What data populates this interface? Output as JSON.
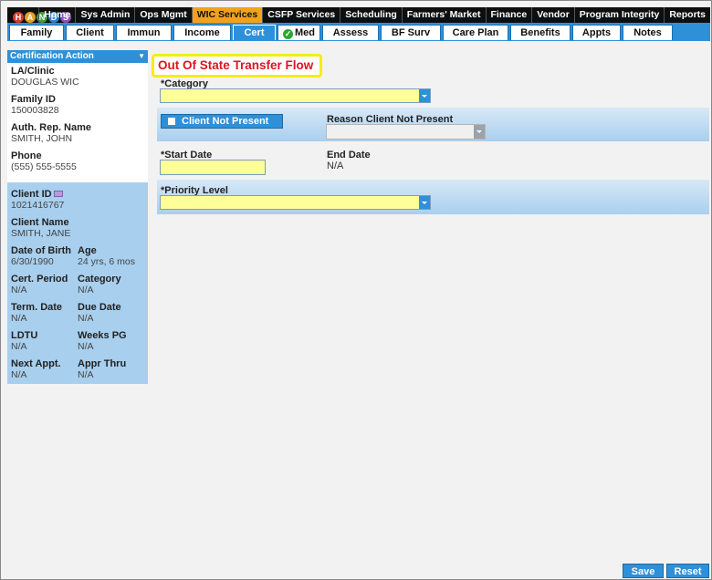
{
  "logo": {
    "letters": [
      "H",
      "A",
      "N",
      "D",
      "S"
    ]
  },
  "top_nav": [
    {
      "label": "Home"
    },
    {
      "label": "Sys Admin"
    },
    {
      "label": "Ops Mgmt"
    },
    {
      "label": "WIC Services",
      "active": true
    },
    {
      "label": "CSFP Services"
    },
    {
      "label": "Scheduling"
    },
    {
      "label": "Farmers' Market"
    },
    {
      "label": "Finance"
    },
    {
      "label": "Vendor"
    },
    {
      "label": "Program Integrity"
    },
    {
      "label": "Reports"
    }
  ],
  "tabs": [
    {
      "label": "Family"
    },
    {
      "label": "Client"
    },
    {
      "label": "Immun"
    },
    {
      "label": "Income"
    },
    {
      "label": "Cert",
      "active": true
    },
    {
      "label": "Med",
      "check": true
    },
    {
      "label": "Assess"
    },
    {
      "label": "BF Surv"
    },
    {
      "label": "Care Plan"
    },
    {
      "label": "Benefits"
    },
    {
      "label": "Appts"
    },
    {
      "label": "Notes"
    }
  ],
  "left_panel": {
    "header": "Certification Action",
    "fields": [
      {
        "label": "LA/Clinic",
        "value": "DOUGLAS WIC"
      },
      {
        "label": "Family ID",
        "value": "150003828"
      },
      {
        "label": "Auth. Rep. Name",
        "value": "SMITH, JOHN"
      },
      {
        "label": "Phone",
        "value": "(555) 555-5555"
      }
    ],
    "client": {
      "client_id_label": "Client ID",
      "client_id": "1021416767",
      "client_name_label": "Client Name",
      "client_name": "SMITH, JANE",
      "pairs": [
        [
          {
            "label": "Date of Birth",
            "value": "6/30/1990"
          },
          {
            "label": "Age",
            "value": "24 yrs, 6 mos"
          }
        ],
        [
          {
            "label": "Cert. Period",
            "value": "N/A"
          },
          {
            "label": "Category",
            "value": "N/A"
          }
        ],
        [
          {
            "label": "Term. Date",
            "value": "N/A"
          },
          {
            "label": "Due Date",
            "value": "N/A"
          }
        ],
        [
          {
            "label": "LDTU",
            "value": "N/A"
          },
          {
            "label": "Weeks PG",
            "value": "N/A"
          }
        ],
        [
          {
            "label": "Next Appt.",
            "value": "N/A"
          },
          {
            "label": "Appr Thru",
            "value": "N/A"
          }
        ]
      ]
    }
  },
  "main": {
    "title": "Out Of State Transfer Flow",
    "category_label": "*Category",
    "client_not_present_label": "Client Not Present",
    "reason_label": "Reason Client Not Present",
    "start_date_label": "*Start Date",
    "end_date_label": "End Date",
    "end_date_value": "N/A",
    "priority_label": "*Priority Level"
  },
  "buttons": {
    "save": "Save",
    "reset": "Reset"
  },
  "colors": {
    "nav_bg": "#0e0e0e",
    "accent_blue": "#2e90d8",
    "active_orange": "#f1a21d",
    "required_yellow": "#ffff99",
    "title_red": "#e0141f",
    "highlight_yellow": "#f4ee12"
  }
}
